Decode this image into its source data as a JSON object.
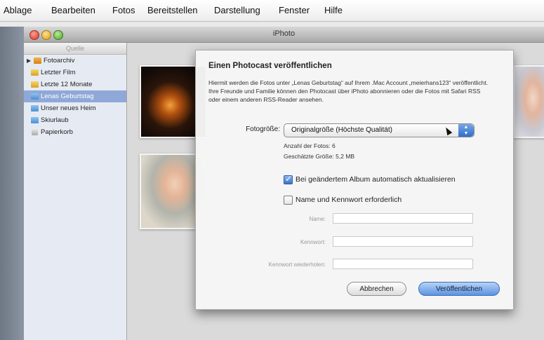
{
  "menubar": {
    "items": [
      "Ablage",
      "Bearbeiten",
      "Fotos",
      "Bereitstellen",
      "Darstellung",
      "Fenster",
      "Hilfe"
    ]
  },
  "window": {
    "title": "iPhoto"
  },
  "sidebar": {
    "header": "Quelle",
    "items": [
      {
        "label": "Fotoarchiv",
        "icon": "library-icon"
      },
      {
        "label": "Letzter Film",
        "icon": "film-roll-icon"
      },
      {
        "label": "Letzte 12 Monate",
        "icon": "calendar-album-icon"
      },
      {
        "label": "Lenas Geburtstag",
        "icon": "album-icon",
        "selected": true
      },
      {
        "label": "Unser neues Heim",
        "icon": "album-icon"
      },
      {
        "label": "Skiurlaub",
        "icon": "album-icon"
      },
      {
        "label": "Papierkorb",
        "icon": "trash-icon"
      }
    ]
  },
  "dialog": {
    "title": "Einen Photocast veröffentlichen",
    "description": "Hiermit werden die Fotos unter „Lenas Geburtstag“ auf Ihrem .Mac Account „meierhans123“ veröffentlicht. Ihre Freunde und Familie können den Photocast über iPhoto abonnieren oder die Fotos mit Safari RSS oder einem anderen RSS-Reader ansehen.",
    "photo_size_label": "Fotogröße:",
    "photo_size_value": "Originalgröße (Höchste Qualität)",
    "photo_count": "Anzahl der Fotos:  6",
    "estimated_size": "Geschätzte Größe:  5,2 MB",
    "auto_update_label": "Bei geändertem Album automatisch aktualisieren",
    "auto_update_checked": true,
    "require_password_label": "Name und Kennwort erforderlich",
    "require_password_checked": false,
    "name_label": "Name:",
    "password_label": "Kennwort:",
    "password_repeat_label": "Kennwort wiederholen:",
    "cancel_label": "Abbrechen",
    "publish_label": "Veröffentlichen"
  },
  "colors": {
    "selection": "#8fa8d8",
    "accent_button": "#5b93e2"
  }
}
